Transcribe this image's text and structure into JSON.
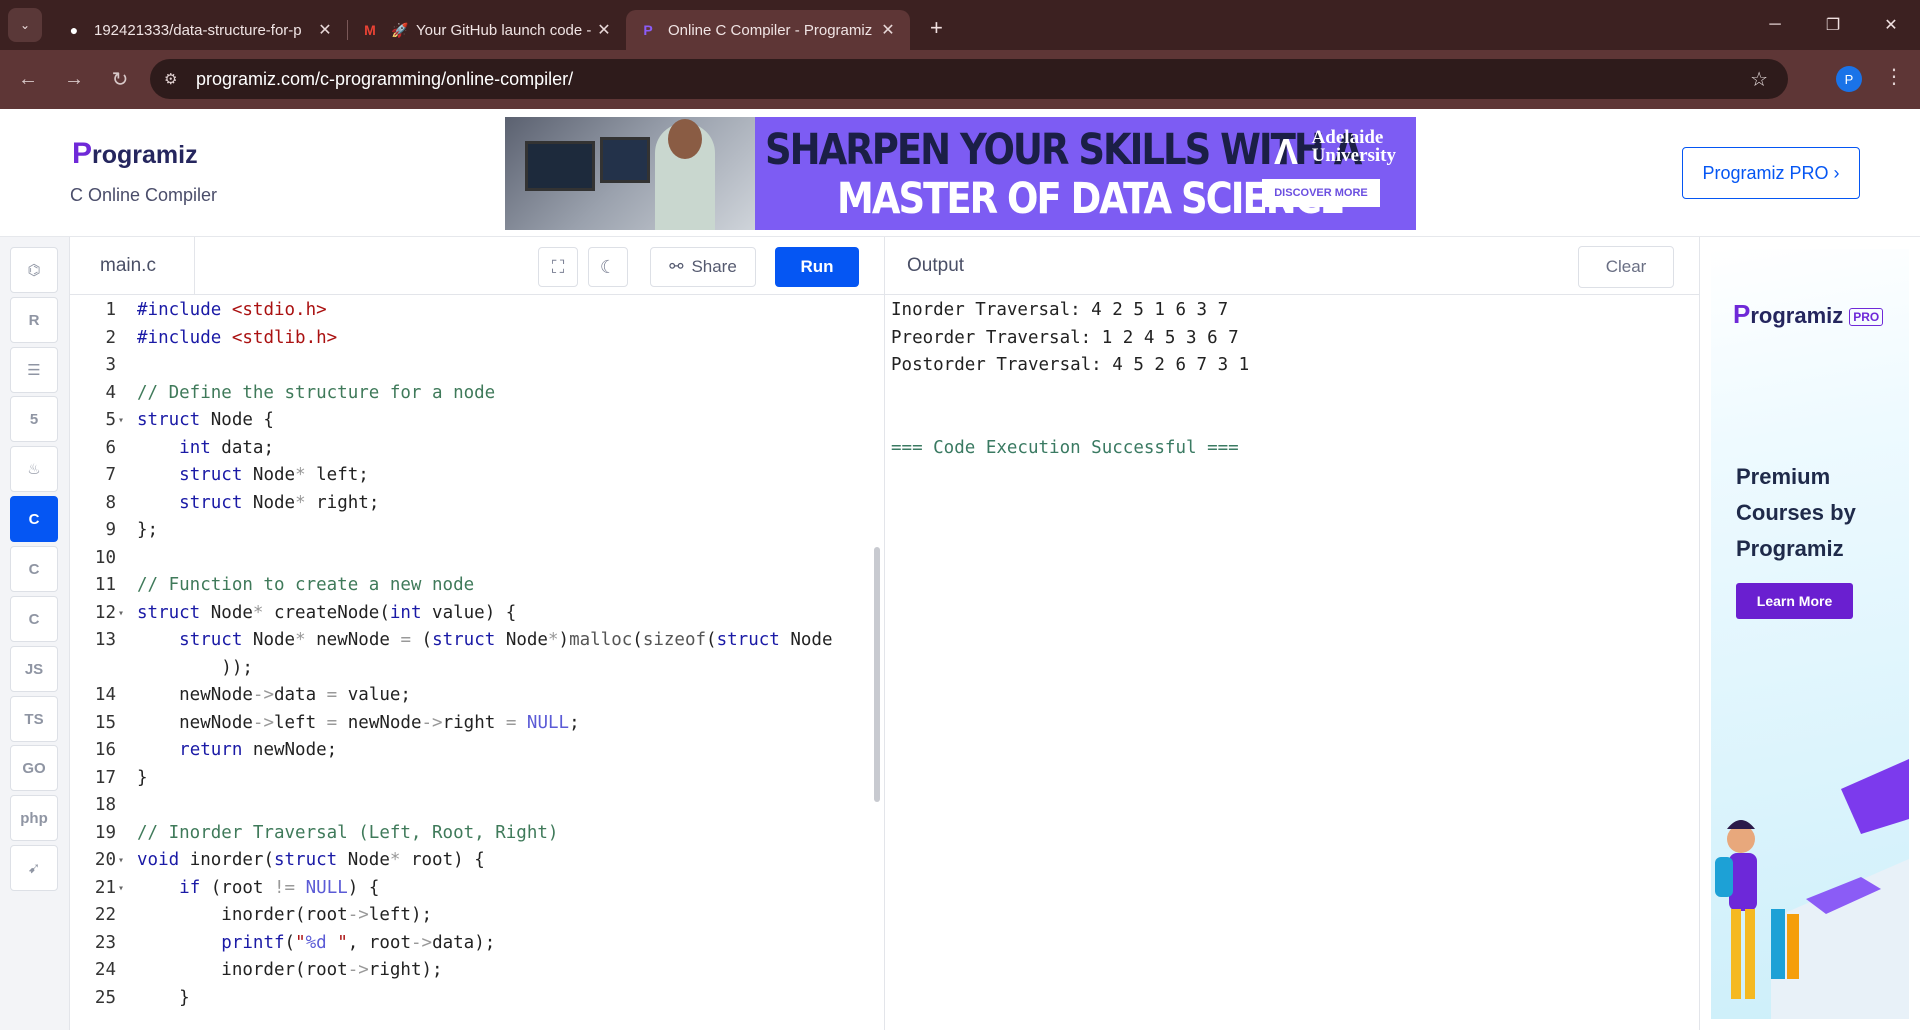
{
  "browser": {
    "tabs": [
      {
        "title": "192421333/data-structure-for-p",
        "icon": "github-icon"
      },
      {
        "title": "Your GitHub launch code -",
        "icon": "gmail-icon"
      },
      {
        "title": "Online C Compiler - Programiz",
        "icon": "programiz-icon"
      }
    ],
    "url": "programiz.com/c-programming/online-compiler/",
    "profile_initial": "P"
  },
  "header": {
    "logo": "rogramiz",
    "logo_p": "P",
    "subtitle": "C Online Compiler",
    "banner_line1": "SHARPEN YOUR SKILLS WITH A",
    "banner_line2": "MASTER OF DATA SCIENCE",
    "banner_uni_line1": "Adelaide",
    "banner_uni_line2": "University",
    "banner_cta": "DISCOVER MORE",
    "pro_button": "Programiz PRO ›"
  },
  "languages": [
    {
      "name": "python-icon",
      "glyph": "⌬"
    },
    {
      "name": "r-icon",
      "glyph": "R"
    },
    {
      "name": "sql-icon",
      "glyph": "☰"
    },
    {
      "name": "html-icon",
      "glyph": "5"
    },
    {
      "name": "java-icon",
      "glyph": "♨"
    },
    {
      "name": "c-icon",
      "glyph": "C",
      "active": true
    },
    {
      "name": "cpp-icon",
      "glyph": "C"
    },
    {
      "name": "csharp-icon",
      "glyph": "C"
    },
    {
      "name": "js-icon",
      "glyph": "JS"
    },
    {
      "name": "ts-icon",
      "glyph": "TS"
    },
    {
      "name": "go-icon",
      "glyph": "GO"
    },
    {
      "name": "php-icon",
      "glyph": "php"
    },
    {
      "name": "swift-icon",
      "glyph": "➹"
    }
  ],
  "editor": {
    "filename": "main.c",
    "share_label": "Share",
    "run_label": "Run",
    "lines": [
      {
        "n": "1",
        "html": "<span class='kw'>#include</span> <span class='str'>&lt;stdio.h&gt;</span>"
      },
      {
        "n": "2",
        "html": "<span class='kw'>#include</span> <span class='str'>&lt;stdlib.h&gt;</span>"
      },
      {
        "n": "3",
        "html": ""
      },
      {
        "n": "4",
        "html": "<span class='cm'>// Define the structure for a node</span>"
      },
      {
        "n": "5",
        "fold": true,
        "html": "<span class='kw'>struct</span> Node {"
      },
      {
        "n": "6",
        "html": "    <span class='kw'>int</span> data;"
      },
      {
        "n": "7",
        "html": "    <span class='kw'>struct</span> Node<span class='op'>*</span> left;"
      },
      {
        "n": "8",
        "html": "    <span class='kw'>struct</span> Node<span class='op'>*</span> right;"
      },
      {
        "n": "9",
        "html": "};"
      },
      {
        "n": "10",
        "html": ""
      },
      {
        "n": "11",
        "html": "<span class='cm'>// Function to create a new node</span>"
      },
      {
        "n": "12",
        "fold": true,
        "html": "<span class='kw'>struct</span> Node<span class='op'>*</span> createNode(<span class='kw'>int</span> value) {"
      },
      {
        "n": "13",
        "html": "    <span class='kw'>struct</span> Node<span class='op'>*</span> newNode <span class='op'>=</span> (<span class='kw'>struct</span> Node<span class='op'>*</span>)<span class='fn'>malloc</span>(<span class='fn'>sizeof</span>(<span class='kw'>struct</span> Node"
      },
      {
        "n": "",
        "html": "        ));"
      },
      {
        "n": "14",
        "html": "    newNode<span class='op'>-&gt;</span>data <span class='op'>=</span> value;"
      },
      {
        "n": "15",
        "html": "    newNode<span class='op'>-&gt;</span>left <span class='op'>=</span> newNode<span class='op'>-&gt;</span>right <span class='op'>=</span> <span class='cst'>NULL</span>;"
      },
      {
        "n": "16",
        "html": "    <span class='kw'>return</span> newNode;"
      },
      {
        "n": "17",
        "html": "}"
      },
      {
        "n": "18",
        "html": ""
      },
      {
        "n": "19",
        "html": "<span class='cm'>// Inorder Traversal (Left, Root, Right)</span>"
      },
      {
        "n": "20",
        "fold": true,
        "html": "<span class='kw'>void</span> inorder(<span class='kw'>struct</span> Node<span class='op'>*</span> root) {"
      },
      {
        "n": "21",
        "fold": true,
        "html": "    <span class='kw'>if</span> (root <span class='op'>!=</span> <span class='cst'>NULL</span>) {"
      },
      {
        "n": "22",
        "html": "        inorder(root<span class='op'>-&gt;</span>left);"
      },
      {
        "n": "23",
        "html": "        <span class='kw'>printf</span>(<span class='str'>\"</span><span class='cst'>%d</span> <span class='str'>\"</span>, root<span class='op'>-&gt;</span>data);"
      },
      {
        "n": "24",
        "html": "        inorder(root<span class='op'>-&gt;</span>right);"
      },
      {
        "n": "25",
        "html": "    }"
      }
    ]
  },
  "output": {
    "title": "Output",
    "clear_label": "Clear",
    "lines": [
      "Inorder Traversal: 4 2 5 1 6 3 7",
      "Preorder Traversal: 1 2 4 5 3 6 7",
      "Postorder Traversal: 4 5 2 6 7 3 1",
      "",
      "",
      "=== Code Execution Successful ==="
    ]
  },
  "side_ad": {
    "logo": "rogramiz",
    "logo_p": "P",
    "pro_badge": "PRO",
    "headline": "Premium Courses by Programiz",
    "cta": "Learn More"
  }
}
